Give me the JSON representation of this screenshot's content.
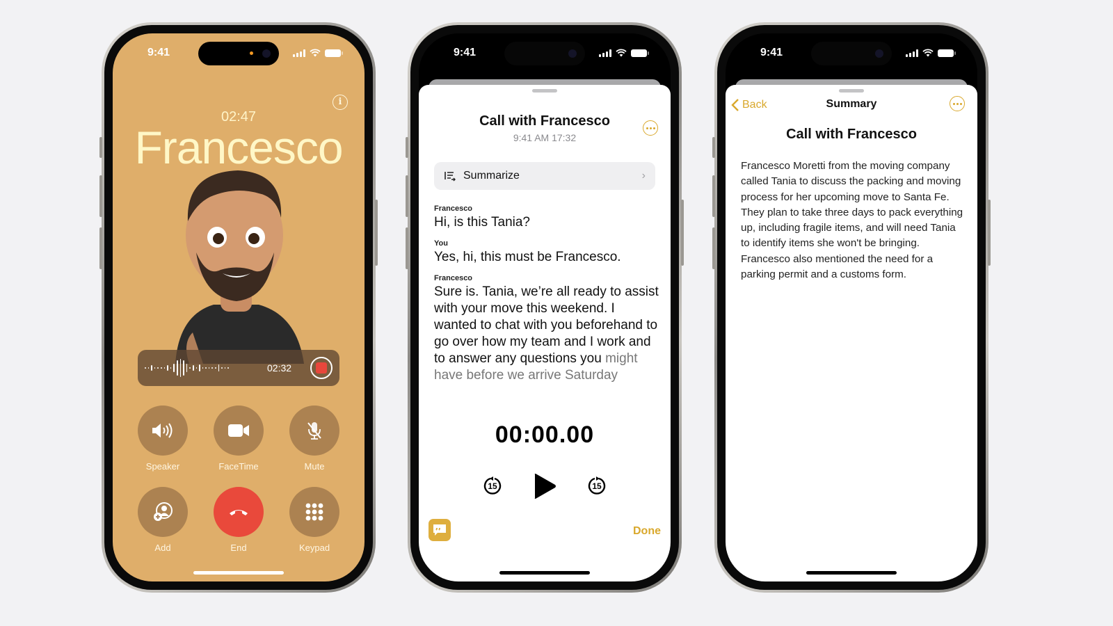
{
  "phones": {
    "call": {
      "status_time": "9:41",
      "call_timer": "02:47",
      "caller_name": "Francesco",
      "recording": {
        "elapsed": "02:32"
      },
      "controls": [
        {
          "label": "Speaker",
          "icon": "speaker-icon"
        },
        {
          "label": "FaceTime",
          "icon": "video-icon"
        },
        {
          "label": "Mute",
          "icon": "mic-slash-icon"
        },
        {
          "label": "Add",
          "icon": "add-person-icon"
        },
        {
          "label": "End",
          "icon": "end-call-icon"
        },
        {
          "label": "Keypad",
          "icon": "keypad-icon"
        }
      ],
      "colors": {
        "background": "#dfae6a",
        "end": "#e9493b",
        "record": "#e8473c"
      }
    },
    "transcript": {
      "status_time": "9:41",
      "title": "Call with Francesco",
      "subtitle": "9:41 AM  17:32",
      "summarize_label": "Summarize",
      "entries": [
        {
          "speaker": "Francesco",
          "text": "Hi, is this Tania?"
        },
        {
          "speaker": "You",
          "text": "Yes, hi, this must be Francesco."
        },
        {
          "speaker": "Francesco",
          "text": "Sure is. Tania, we’re all ready to assist with your move this weekend. I wanted to chat with you beforehand to go over how my team and I work and to answer any questions you",
          "text_faded": "might have before we arrive Saturday"
        }
      ],
      "playback_time": "00:00.00",
      "skip_back_label": "15",
      "skip_forward_label": "15",
      "done_label": "Done",
      "colors": {
        "accent": "#d9a82c"
      }
    },
    "summary": {
      "status_time": "9:41",
      "back_label": "Back",
      "nav_title": "Summary",
      "title": "Call with Francesco",
      "body": "Francesco Moretti from the moving company called Tania to discuss the packing and moving process for her upcoming move to Santa Fe. They plan to take three days to pack everything up, including fragile items, and will need Tania to identify items she won't be bringing. Francesco also mentioned the need for a parking permit and a customs form."
    }
  }
}
